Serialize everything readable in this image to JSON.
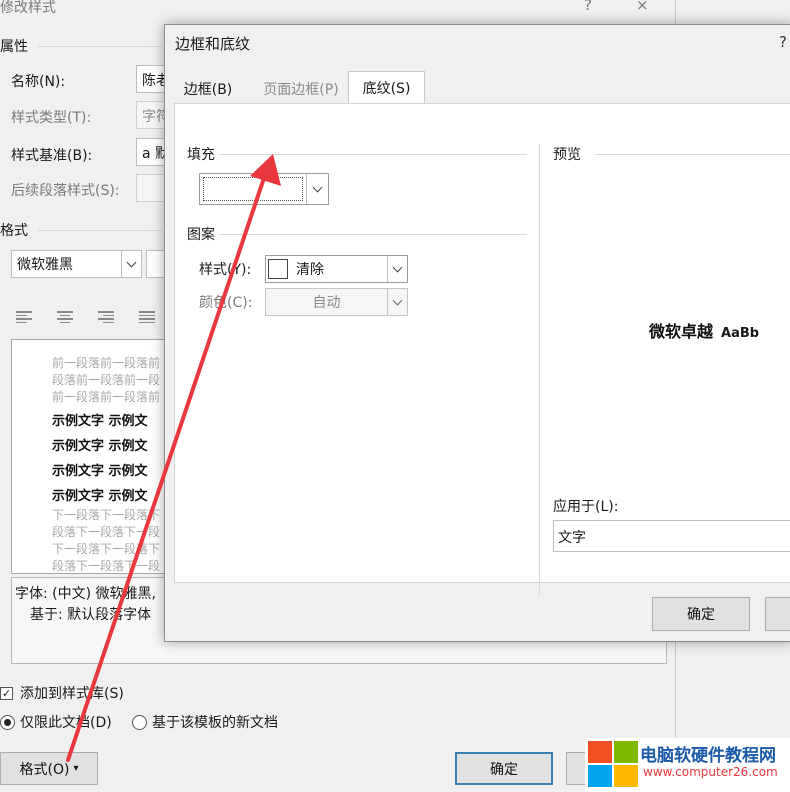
{
  "back_dialog": {
    "title": "修改样式",
    "help_icon": "?",
    "close_icon": "×",
    "properties_header": "属性",
    "name_label": "名称(N):",
    "name_value": "陈老",
    "style_type_label": "样式类型(T):",
    "style_type_value": "字符",
    "based_on_label": "样式基准(B):",
    "based_on_value": "a 默",
    "next_style_label": "后续段落样式(S):",
    "format_header": "格式",
    "font_value": "微软雅黑",
    "preview_prev_lines": [
      "前一段落前一段落前",
      "段落前一段落前一段",
      "前一段落前一段落前"
    ],
    "preview_samples": [
      "示例文字  示例文",
      "示例文字  示例文",
      "示例文字  示例文",
      "示例文字  示例文"
    ],
    "preview_next_lines": [
      "下一段落下一段落下",
      "段落下一段落下一段",
      "下一段落下一段落下",
      "段落下一段落下一段"
    ],
    "desc_line1": "字体: (中文) 微软雅黑,",
    "desc_line2": "基于: 默认段落字体",
    "add_to_gallery": "添加到样式库(S)",
    "only_this_doc": "仅限此文档(D)",
    "new_docs_template": "基于该模板的新文档",
    "format_button": "格式(O)",
    "ok_button": "确定"
  },
  "front_dialog": {
    "title": "边框和底纹",
    "help_icon": "?",
    "tabs": [
      "边框(B)",
      "页面边框(P)",
      "底纹(S)"
    ],
    "active_tab": 2,
    "fill_header": "填充",
    "fill_value": "",
    "pattern_header": "图案",
    "style_label": "样式(Y):",
    "style_value": "清除",
    "color_label": "颜色(C):",
    "color_value": "自动",
    "preview_header": "预览",
    "preview_text_cn": "微软卓越",
    "preview_text_en": "AaBb",
    "apply_to_label": "应用于(L):",
    "apply_to_value": "文字",
    "ok_button": "确定"
  },
  "watermark": {
    "title": "电脑软硬件教程网",
    "url": "www.computer26.com"
  },
  "colors": {
    "arrow": "#e8383d",
    "accent_blue": "#3c7fb1",
    "watermark_title": "#1a5aa8",
    "watermark_url": "#e8383d"
  }
}
